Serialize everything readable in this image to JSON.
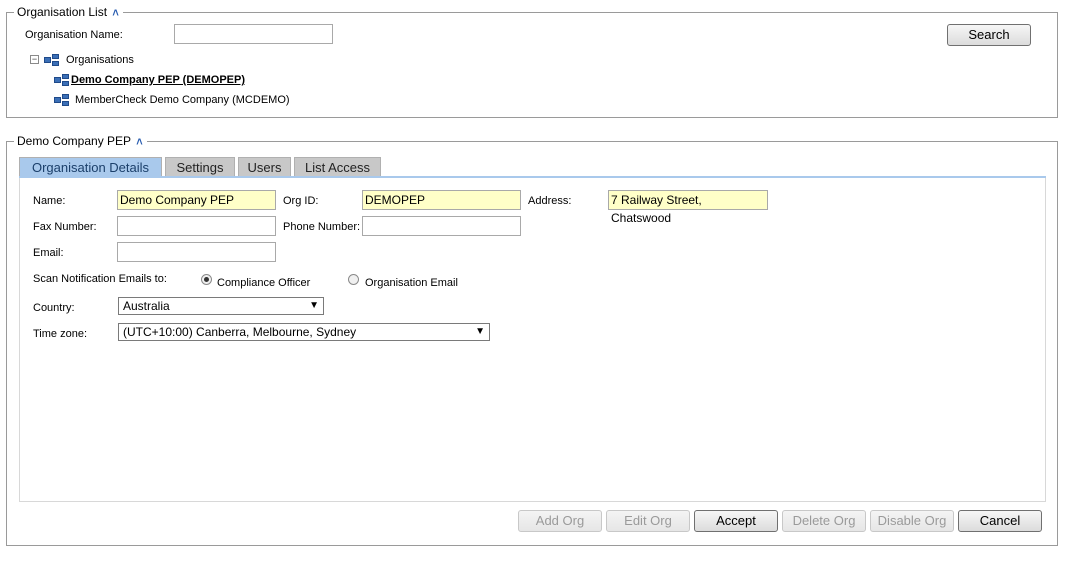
{
  "org_list": {
    "title": "Organisation List",
    "collapse_glyph": "˄",
    "org_name_label": "Organisation Name:",
    "org_name_value": "",
    "search_label": "Search",
    "tree": {
      "root_toggle": "−",
      "root_label": "Organisations",
      "items": [
        {
          "label": "Demo Company PEP (DEMOPEP)",
          "selected": true
        },
        {
          "label": "MemberCheck Demo Company (MCDEMO)",
          "selected": false
        }
      ]
    }
  },
  "details": {
    "title": "Demo Company PEP",
    "collapse_glyph": "˄",
    "tabs": [
      {
        "label": "Organisation Details",
        "active": true
      },
      {
        "label": "Settings",
        "active": false
      },
      {
        "label": "Users",
        "active": false
      },
      {
        "label": "List Access",
        "active": false
      }
    ],
    "form": {
      "name_label": "Name:",
      "name_value": "Demo Company PEP",
      "orgid_label": "Org ID:",
      "orgid_value": "DEMOPEP",
      "address_label": "Address:",
      "address_value": "7 Railway Street, Chatswood",
      "fax_label": "Fax Number:",
      "fax_value": "",
      "phone_label": "Phone Number:",
      "phone_value": "",
      "email_label": "Email:",
      "email_value": "",
      "scan_label": "Scan Notification Emails to:",
      "radio_options": [
        {
          "label": "Compliance Officer",
          "selected": true
        },
        {
          "label": "Organisation Email",
          "selected": false
        }
      ],
      "country_label": "Country:",
      "country_value": "Australia",
      "timezone_label": "Time zone:",
      "timezone_value": "(UTC+10:00) Canberra, Melbourne, Sydney",
      "dropdown_glyph": "▼"
    },
    "buttons": {
      "add": "Add Org",
      "edit": "Edit Org",
      "accept": "Accept",
      "delete": "Delete Org",
      "disable": "Disable Org",
      "cancel": "Cancel"
    }
  },
  "colors": {
    "active_tab": "#a9c9ec",
    "inactive_tab": "#c8c8c8",
    "readonly_field": "#ffffc8",
    "accent": "#2a5db0"
  }
}
